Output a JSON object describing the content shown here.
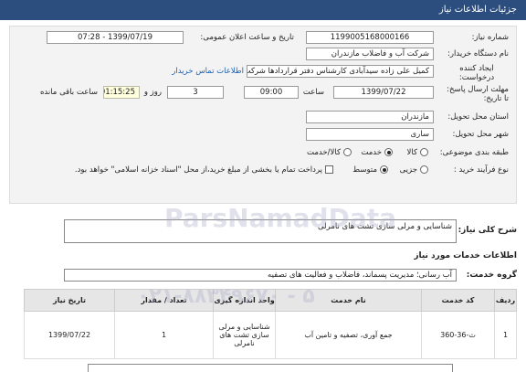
{
  "header": {
    "title": "جزئیات اطلاعات نیاز"
  },
  "form": {
    "need_number": {
      "label": "شماره نیاز:",
      "value": "1199005168000166"
    },
    "announce_datetime": {
      "label": "تاریخ و ساعت اعلان عمومی:",
      "value": "1399/07/19 - 07:28"
    },
    "buyer_org": {
      "label": "نام دستگاه خریدار:",
      "value": "شرکت آب و فاضلاب مازندران"
    },
    "requester": {
      "label": "ایجاد کننده درخواست:",
      "value": "کمیل علی زاده سیدآبادی کارشناس دفتر قراردادها شرکت آب و فاضلاب مازندران"
    },
    "buyer_contact_link": "اطلاعات تماس خریدار",
    "deadline": {
      "label": "مهلت ارسال پاسخ: تا تاریخ:",
      "date": "1399/07/22",
      "time_label": "ساعت",
      "time": "09:00",
      "days": "3",
      "days_label": "روز و",
      "remaining": "01:15:25",
      "remaining_label": "ساعت باقی مانده"
    },
    "province": {
      "label": "استان محل تحویل:",
      "value": "مازندران"
    },
    "city": {
      "label": "شهر محل تحویل:",
      "value": "ساری"
    },
    "category": {
      "label": "طبقه بندی موضوعی:",
      "options": [
        "کالا",
        "خدمت",
        "کالا/خدمت"
      ],
      "selected": "خدمت"
    },
    "process_type": {
      "label": "نوع فرآیند خرید :",
      "options": [
        "جزیی",
        "متوسط"
      ],
      "selected": "متوسط",
      "payment_note": "پرداخت تمام یا بخشی از مبلغ خرید،از محل \"اسناد خزانه اسلامی\" خواهد بود."
    }
  },
  "description": {
    "label": "شرح کلی نیاز:",
    "value": "شناسایی و مرلی سازی تشت های نامرلی"
  },
  "services_section": {
    "title": "اطلاعات خدمات مورد نیاز"
  },
  "service_group": {
    "label": "گروه خدمت:",
    "value": "آب رسانی؛ مدیریت پسماند، فاضلاب و فعالیت های تصفیه"
  },
  "table": {
    "headers": [
      "ردیف",
      "کد خدمت",
      "نام خدمت",
      "واحد اندازه گیری",
      "تعداد / مقدار",
      "تاریخ نیاز"
    ],
    "rows": [
      [
        "1",
        "ث-36-360",
        "جمع آوری، تصفیه و تامین آب",
        "شناسایی و مرلی سازی تشت های نامرلی",
        "1",
        "1399/07/22"
      ]
    ]
  },
  "watermark": {
    "line1": "ParsNamadData",
    "line2": "۰۲۱-۸۸۳۴۹۶۷۰ - ۵"
  }
}
